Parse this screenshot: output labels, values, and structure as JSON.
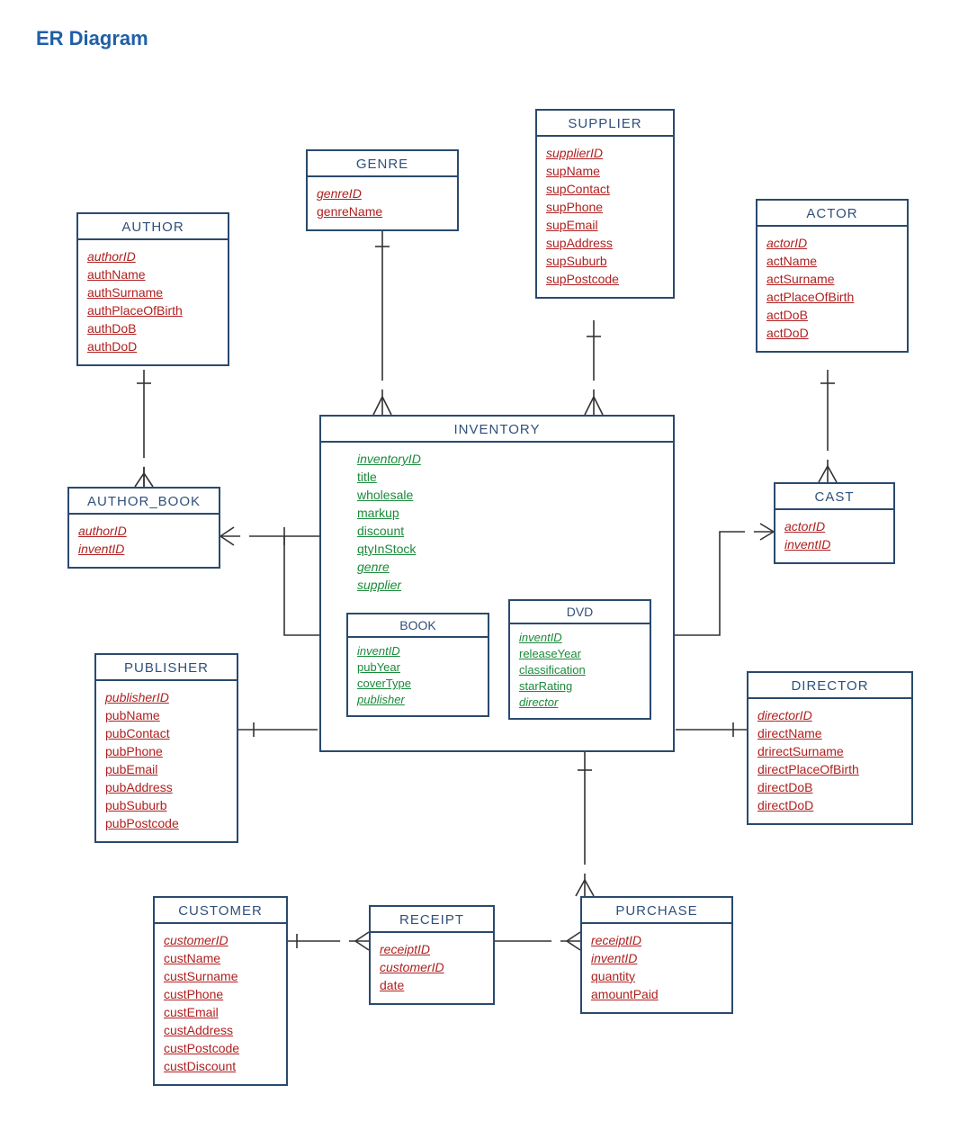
{
  "title": "ER Diagram",
  "entities": {
    "author": {
      "name": "AUTHOR",
      "fields": [
        {
          "text": "authorID",
          "cls": "pk red"
        },
        {
          "text": "authName",
          "cls": "ul red"
        },
        {
          "text": "authSurname",
          "cls": "ul red"
        },
        {
          "text": "authPlaceOfBirth",
          "cls": "ul red"
        },
        {
          "text": "authDoB",
          "cls": "ul red"
        },
        {
          "text": "authDoD",
          "cls": "ul red"
        }
      ]
    },
    "genre": {
      "name": "GENRE",
      "fields": [
        {
          "text": "genreID",
          "cls": "pk red"
        },
        {
          "text": "genreName",
          "cls": "ul red"
        }
      ]
    },
    "supplier": {
      "name": "SUPPLIER",
      "fields": [
        {
          "text": "supplierID",
          "cls": "pk red"
        },
        {
          "text": "supName",
          "cls": "ul red"
        },
        {
          "text": "supContact",
          "cls": "ul red"
        },
        {
          "text": "supPhone",
          "cls": "ul red"
        },
        {
          "text": "supEmail",
          "cls": "ul red"
        },
        {
          "text": "supAddress",
          "cls": "ul red"
        },
        {
          "text": "supSuburb",
          "cls": "ul red"
        },
        {
          "text": "supPostcode",
          "cls": "ul red"
        }
      ]
    },
    "actor": {
      "name": "ACTOR",
      "fields": [
        {
          "text": "actorID",
          "cls": "pk red"
        },
        {
          "text": "actName",
          "cls": "ul red"
        },
        {
          "text": "actSurname",
          "cls": "ul red"
        },
        {
          "text": "actPlaceOfBirth",
          "cls": "ul red"
        },
        {
          "text": "actDoB",
          "cls": "ul red"
        },
        {
          "text": "actDoD",
          "cls": "ul red"
        }
      ]
    },
    "author_book": {
      "name": "AUTHOR_BOOK",
      "fields": [
        {
          "text": "authorID",
          "cls": "fk red"
        },
        {
          "text": "inventID",
          "cls": "fk red"
        }
      ]
    },
    "inventory": {
      "name": "INVENTORY",
      "fields": [
        {
          "text": "inventoryID",
          "cls": "pk green"
        },
        {
          "text": "title",
          "cls": "ul green"
        },
        {
          "text": "wholesale",
          "cls": "ul green"
        },
        {
          "text": "markup",
          "cls": "ul green"
        },
        {
          "text": "discount",
          "cls": "ul green"
        },
        {
          "text": "qtyInStock",
          "cls": "ul green"
        },
        {
          "text": "genre",
          "cls": "fk green"
        },
        {
          "text": "supplier",
          "cls": "fk green"
        }
      ]
    },
    "book": {
      "name": "BOOK",
      "fields": [
        {
          "text": "inventID",
          "cls": "fk green"
        },
        {
          "text": "pubYear",
          "cls": "ul green"
        },
        {
          "text": "coverType",
          "cls": "ul green"
        },
        {
          "text": "publisher",
          "cls": "fk green"
        }
      ]
    },
    "dvd": {
      "name": "DVD",
      "fields": [
        {
          "text": "inventID",
          "cls": "fk green"
        },
        {
          "text": "releaseYear",
          "cls": "ul green"
        },
        {
          "text": "classification",
          "cls": "ul green"
        },
        {
          "text": "starRating",
          "cls": "ul green"
        },
        {
          "text": "director",
          "cls": "fk green"
        }
      ]
    },
    "cast": {
      "name": "CAST",
      "fields": [
        {
          "text": "actorID",
          "cls": "fk red"
        },
        {
          "text": "inventID",
          "cls": "fk red"
        }
      ]
    },
    "publisher": {
      "name": "PUBLISHER",
      "fields": [
        {
          "text": "publisherID",
          "cls": "pk red"
        },
        {
          "text": "pubName",
          "cls": "ul red"
        },
        {
          "text": "pubContact",
          "cls": "ul red"
        },
        {
          "text": "pubPhone",
          "cls": "ul red"
        },
        {
          "text": "pubEmail",
          "cls": "ul red"
        },
        {
          "text": "pubAddress",
          "cls": "ul red"
        },
        {
          "text": "pubSuburb",
          "cls": "ul red"
        },
        {
          "text": "pubPostcode",
          "cls": "ul red"
        }
      ]
    },
    "director": {
      "name": "DIRECTOR",
      "fields": [
        {
          "text": "directorID",
          "cls": "pk red"
        },
        {
          "text": "directName",
          "cls": "ul red"
        },
        {
          "text": "drirectSurname",
          "cls": "ul red"
        },
        {
          "text": "directPlaceOfBirth",
          "cls": "ul red"
        },
        {
          "text": "directDoB",
          "cls": "ul red"
        },
        {
          "text": "directDoD",
          "cls": "ul red"
        }
      ]
    },
    "customer": {
      "name": "CUSTOMER",
      "fields": [
        {
          "text": "customerID",
          "cls": "pk red"
        },
        {
          "text": "custName",
          "cls": "ul red"
        },
        {
          "text": "custSurname",
          "cls": "ul red"
        },
        {
          "text": "custPhone",
          "cls": "ul red"
        },
        {
          "text": "custEmail",
          "cls": "ul red"
        },
        {
          "text": "custAddress",
          "cls": "ul red"
        },
        {
          "text": "custPostcode",
          "cls": "ul red"
        },
        {
          "text": "custDiscount",
          "cls": "ul red"
        }
      ]
    },
    "receipt": {
      "name": "RECEIPT",
      "fields": [
        {
          "text": "receiptID",
          "cls": "pk red"
        },
        {
          "text": "customerID",
          "cls": "fk red"
        },
        {
          "text": "date",
          "cls": "ul red"
        }
      ]
    },
    "purchase": {
      "name": "PURCHASE",
      "fields": [
        {
          "text": "receiptID",
          "cls": "fk red"
        },
        {
          "text": "inventID",
          "cls": "fk red"
        },
        {
          "text": "quantity",
          "cls": "ul red"
        },
        {
          "text": "amountPaid",
          "cls": "ul red"
        }
      ]
    }
  },
  "relationships": [
    {
      "from": "AUTHOR",
      "to": "AUTHOR_BOOK",
      "card": "1..*",
      "note": "author -o< author_book"
    },
    {
      "from": "AUTHOR_BOOK",
      "to": "BOOK",
      "card": "*..1",
      "note": "author_book >o- book"
    },
    {
      "from": "GENRE",
      "to": "INVENTORY",
      "card": "1..*",
      "note": "genre -o< inventory"
    },
    {
      "from": "SUPPLIER",
      "to": "INVENTORY",
      "card": "1..*",
      "note": "supplier -o< inventory"
    },
    {
      "from": "PUBLISHER",
      "to": "BOOK",
      "card": "1..*",
      "note": "publisher -o< book"
    },
    {
      "from": "ACTOR",
      "to": "CAST",
      "card": "1..*",
      "note": "actor -o< cast"
    },
    {
      "from": "CAST",
      "to": "DVD",
      "card": "*..1",
      "note": "cast >o- dvd"
    },
    {
      "from": "DIRECTOR",
      "to": "DVD",
      "card": "1..*",
      "note": "director -o< dvd"
    },
    {
      "from": "INVENTORY",
      "to": "PURCHASE",
      "card": "1..*",
      "note": "inventory -o< purchase"
    },
    {
      "from": "RECEIPT",
      "to": "PURCHASE",
      "card": "1..*",
      "note": "receipt -o< purchase"
    },
    {
      "from": "CUSTOMER",
      "to": "RECEIPT",
      "card": "1..*",
      "note": "customer -o< receipt"
    }
  ]
}
